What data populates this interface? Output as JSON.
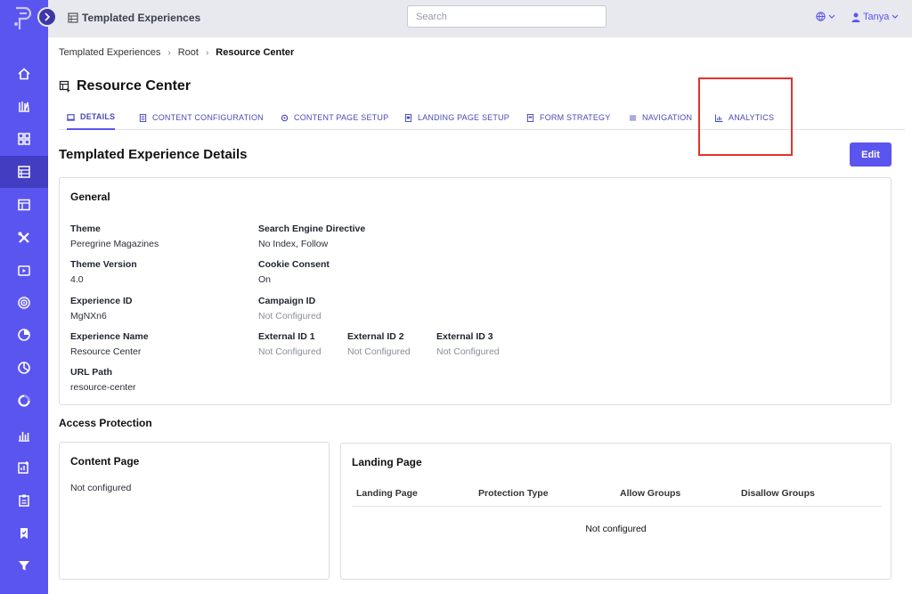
{
  "header": {
    "app_title": "Templated Experiences",
    "search_placeholder": "Search",
    "user_name": "Tanya"
  },
  "breadcrumb": [
    "Templated Experiences",
    "Root",
    "Resource Center"
  ],
  "page_title": "Resource Center",
  "tabs": [
    {
      "label": "DETAILS",
      "icon": "details-icon"
    },
    {
      "label": "CONTENT CONFIGURATION",
      "icon": "document-icon"
    },
    {
      "label": "CONTENT PAGE SETUP",
      "icon": "cog-icon"
    },
    {
      "label": "LANDING PAGE SETUP",
      "icon": "page-icon"
    },
    {
      "label": "FORM STRATEGY",
      "icon": "form-icon"
    },
    {
      "label": "NAVIGATION",
      "icon": "menu-icon"
    },
    {
      "label": "ANALYTICS",
      "icon": "chart-icon"
    }
  ],
  "details": {
    "title": "Templated Experience Details",
    "edit_label": "Edit"
  },
  "general": {
    "title": "General",
    "fields": {
      "theme": {
        "label": "Theme",
        "value": "Peregrine Magazines"
      },
      "theme_version": {
        "label": "Theme Version",
        "value": "4.0"
      },
      "experience_id": {
        "label": "Experience ID",
        "value": "MgNXn6"
      },
      "experience_name": {
        "label": "Experience Name",
        "value": "Resource Center"
      },
      "url_path": {
        "label": "URL Path",
        "value": "resource-center"
      },
      "search_engine_directive": {
        "label": "Search Engine Directive",
        "value": "No Index, Follow"
      },
      "cookie_consent": {
        "label": "Cookie Consent",
        "value": "On"
      },
      "campaign_id": {
        "label": "Campaign ID",
        "value": "Not Configured"
      },
      "external_id_1": {
        "label": "External ID 1",
        "value": "Not Configured"
      },
      "external_id_2": {
        "label": "External ID 2",
        "value": "Not Configured"
      },
      "external_id_3": {
        "label": "External ID 3",
        "value": "Not Configured"
      }
    }
  },
  "access_protection": {
    "title": "Access Protection",
    "content_page": {
      "title": "Content Page",
      "value": "Not configured"
    },
    "landing_page": {
      "title": "Landing Page",
      "columns": [
        "Landing Page",
        "Protection Type",
        "Allow Groups",
        "Disallow Groups"
      ],
      "empty_text": "Not configured"
    }
  },
  "colors": {
    "accent": "#5b55f0",
    "sidebar_active": "#433dc2",
    "highlight": "#e3322c"
  }
}
